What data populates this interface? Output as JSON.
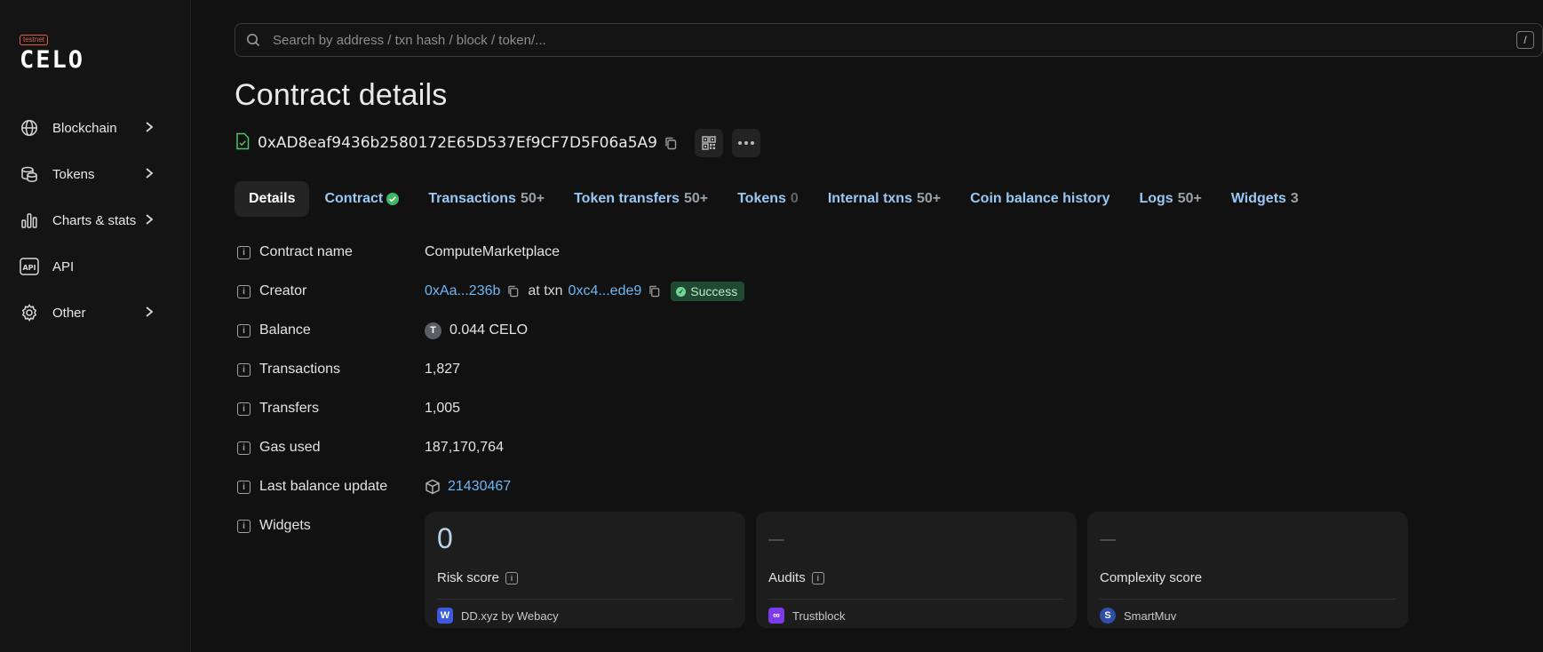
{
  "logo": {
    "badge": "testnet",
    "word": "CELO"
  },
  "sidebar": {
    "items": [
      {
        "label": "Blockchain",
        "icon": "globe-icon",
        "has_chevron": true
      },
      {
        "label": "Tokens",
        "icon": "coins-icon",
        "has_chevron": true
      },
      {
        "label": "Charts & stats",
        "icon": "bar-chart-icon",
        "has_chevron": true
      },
      {
        "label": "API",
        "icon": "api-icon",
        "has_chevron": false
      },
      {
        "label": "Other",
        "icon": "gear-icon",
        "has_chevron": true
      }
    ]
  },
  "search": {
    "placeholder": "Search by address / txn hash / block / token/...",
    "shortcut": "/"
  },
  "page": {
    "title": "Contract details"
  },
  "address": {
    "value": "0xAD8eaf9436b2580172E65D537Ef9CF7D5F06a5A9"
  },
  "tabs": [
    {
      "label": "Details",
      "count": ""
    },
    {
      "label": "Contract",
      "count": "",
      "verified": true
    },
    {
      "label": "Transactions",
      "count": "50+"
    },
    {
      "label": "Token transfers",
      "count": "50+"
    },
    {
      "label": "Tokens",
      "count": "0"
    },
    {
      "label": "Internal txns",
      "count": "50+"
    },
    {
      "label": "Coin balance history",
      "count": ""
    },
    {
      "label": "Logs",
      "count": "50+"
    },
    {
      "label": "Widgets",
      "count": "3"
    }
  ],
  "details": {
    "contract_name": {
      "label": "Contract name",
      "value": "ComputeMarketplace"
    },
    "creator": {
      "label": "Creator",
      "address": "0xAa...236b",
      "at_txn": "at txn",
      "txn": "0xc4...ede9",
      "status": "Success"
    },
    "balance": {
      "label": "Balance",
      "token_letter": "T",
      "value": "0.044 CELO"
    },
    "transactions": {
      "label": "Transactions",
      "value": "1,827"
    },
    "transfers": {
      "label": "Transfers",
      "value": "1,005"
    },
    "gas_used": {
      "label": "Gas used",
      "value": "187,170,764"
    },
    "last_balance_update": {
      "label": "Last balance update",
      "value": "21430467"
    },
    "widgets": {
      "label": "Widgets"
    }
  },
  "widgets": [
    {
      "value": "0",
      "label": "Risk score",
      "has_info": true,
      "provider": "DD.xyz by Webacy",
      "provider_color": "#3b5bdb"
    },
    {
      "value": "",
      "label": "Audits",
      "has_info": true,
      "provider": "Trustblock",
      "provider_color": "#7c3aed"
    },
    {
      "value": "",
      "label": "Complexity score",
      "has_info": false,
      "provider": "SmartMuv",
      "provider_color": "#2f4fa8"
    }
  ],
  "colors": {
    "link": "#6fb7f5",
    "success_bg": "#1f4a31",
    "tab": "#9ac8f2"
  }
}
